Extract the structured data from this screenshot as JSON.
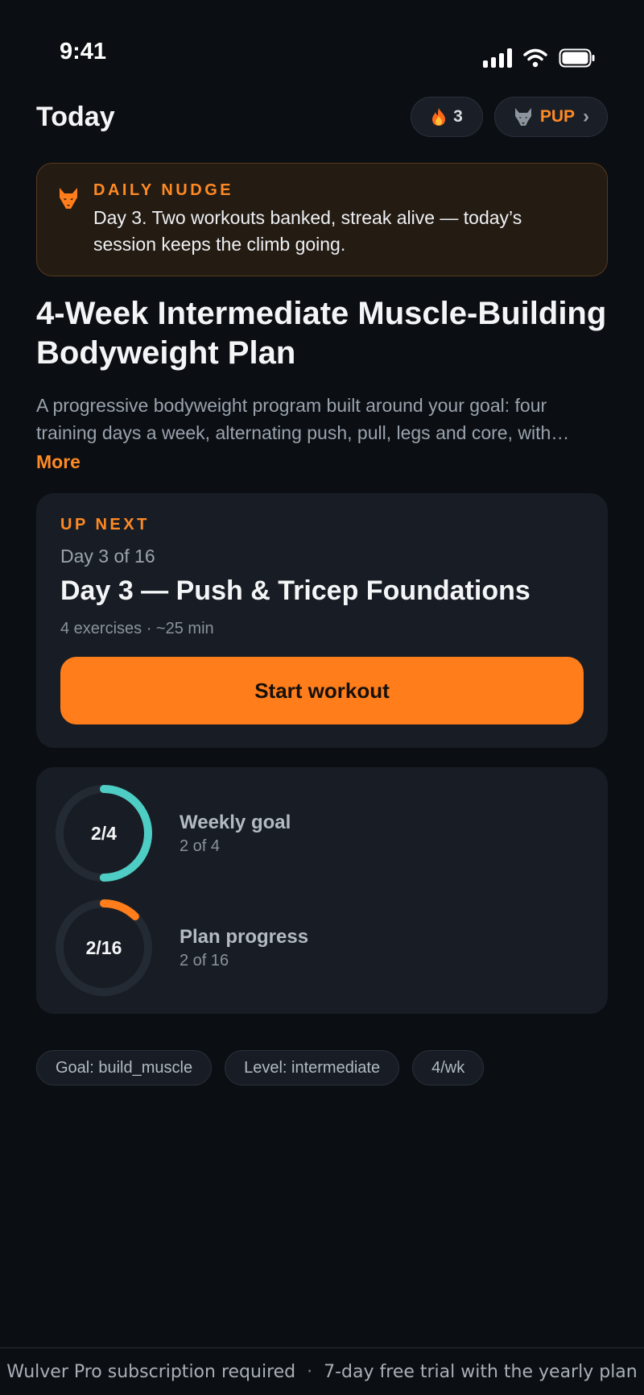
{
  "status_bar": {
    "time": "9:41"
  },
  "header": {
    "title": "Today",
    "streak_count": "3",
    "rank_label": "PUP",
    "rank_chevron": "›"
  },
  "nudge": {
    "label": "DAILY NUDGE",
    "text": "Day 3. Two workouts banked, streak alive — today’s session keeps the climb going."
  },
  "plan": {
    "title": "4-Week Intermediate Muscle-Building Bodyweight Plan",
    "description": "A progressive bodyweight program built around your goal: four training days a week, alternating push, pull, legs and core, with…",
    "more_label": "More"
  },
  "up_next": {
    "label": "UP NEXT",
    "day_count": "Day 3 of 16",
    "title": "Day 3 — Push & Tricep Foundations",
    "meta": "4 exercises · ~25 min",
    "button_label": "Start workout"
  },
  "progress": {
    "weekly": {
      "ring_text": "2/4",
      "label": "Weekly goal",
      "sub": "2 of 4",
      "value": 2,
      "total": 4,
      "color": "#4ecdc4"
    },
    "plan": {
      "ring_text": "2/16",
      "label": "Plan progress",
      "sub": "2 of 16",
      "value": 2,
      "total": 16,
      "color": "#ff7d1a"
    }
  },
  "tags": [
    {
      "label": "Goal: build_muscle"
    },
    {
      "label": "Level: intermediate"
    },
    {
      "label": "4/wk"
    }
  ],
  "footer": {
    "left": "Wulver Pro subscription required",
    "separator": "·",
    "right": "7-day free trial with the yearly plan"
  },
  "icons": {
    "streak": "flame-icon",
    "rank": "wolf-icon",
    "nudge": "wolf-icon"
  },
  "colors": {
    "accent": "#ff7d1a",
    "teal": "#4ecdc4",
    "background": "#0b0e13",
    "card": "#181d25"
  }
}
